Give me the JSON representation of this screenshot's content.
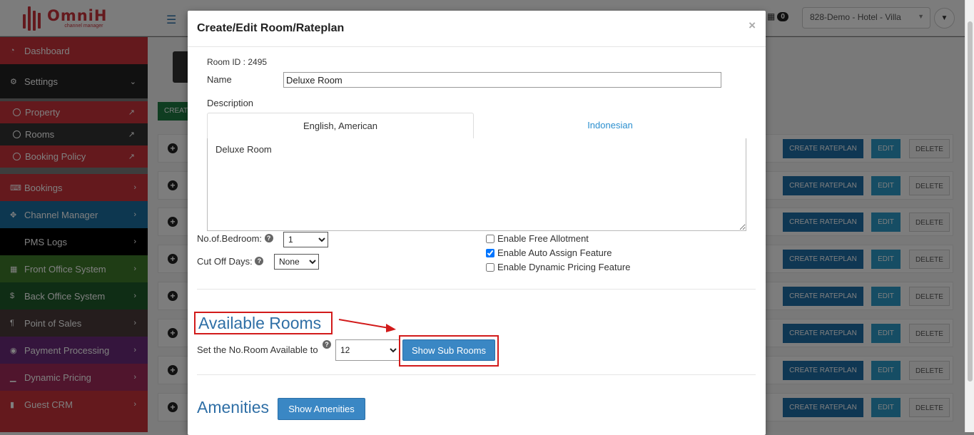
{
  "topbar": {
    "brand": "OmniH",
    "brand_tagline": "channel manager",
    "hamburger_icon": "menu-icon",
    "calendar_badge_count": "0",
    "hotel_selector": "828-Demo - Hotel - Villa"
  },
  "sidebar": {
    "items": [
      {
        "label": "Dashboard",
        "icon": "dashboard-icon",
        "color": "#c8323a"
      },
      {
        "label": "Settings",
        "icon": "gear-icon",
        "color": "#222222"
      },
      {
        "label": "Bookings",
        "icon": "keyboard-icon",
        "color": "#c8323a"
      },
      {
        "label": "Channel Manager",
        "icon": "arrows-icon",
        "color": "#1a6fa0"
      },
      {
        "label": "PMS Logs",
        "icon": "",
        "color": "#000000"
      },
      {
        "label": "Front Office System",
        "icon": "calendar-icon",
        "color": "#3f7a2a"
      },
      {
        "label": "Back Office System",
        "icon": "dollar-icon",
        "color": "#1f5a2a"
      },
      {
        "label": "Point of Sales",
        "icon": "cutlery-icon",
        "color": "#4a3a3a"
      },
      {
        "label": "Payment Processing",
        "icon": "target-icon",
        "color": "#6a2a7a"
      },
      {
        "label": "Dynamic Pricing",
        "icon": "chart-icon",
        "color": "#a02a5a"
      },
      {
        "label": "Guest CRM",
        "icon": "file-icon",
        "color": "#c8323a"
      }
    ],
    "settings_sub": [
      {
        "label": "Property"
      },
      {
        "label": "Rooms"
      },
      {
        "label": "Booking Policy"
      }
    ]
  },
  "main": {
    "create_button": "CREAT",
    "row_buttons": {
      "create_rateplan": "CREATE RATEPLAN",
      "edit": "EDIT",
      "delete": "DELETE"
    }
  },
  "modal": {
    "title": "Create/Edit Room/Rateplan",
    "close": "×",
    "room_id_label": "Room ID : 2495",
    "name_label": "Name",
    "name_value": "Deluxe Room",
    "description_label": "Description",
    "tabs": [
      "English, American",
      "Indonesian"
    ],
    "description_text": "Deluxe Room",
    "bedroom_label": "No.of.Bedroom:",
    "bedroom_value": "1",
    "cutoff_label": "Cut Off Days:",
    "cutoff_value": "None",
    "checkboxes": [
      {
        "label": "Enable Free Allotment",
        "checked": false
      },
      {
        "label": "Enable Auto Assign Feature",
        "checked": true
      },
      {
        "label": "Enable Dynamic Pricing Feature",
        "checked": false
      }
    ],
    "available_rooms_title": "Available Rooms",
    "set_available_label": "Set the No.Room Available to",
    "available_value": "12",
    "show_sub_rooms": "Show Sub Rooms",
    "amenities_title": "Amenities",
    "show_amenities": "Show Amenities",
    "highlight_color": "#d21a1a"
  }
}
